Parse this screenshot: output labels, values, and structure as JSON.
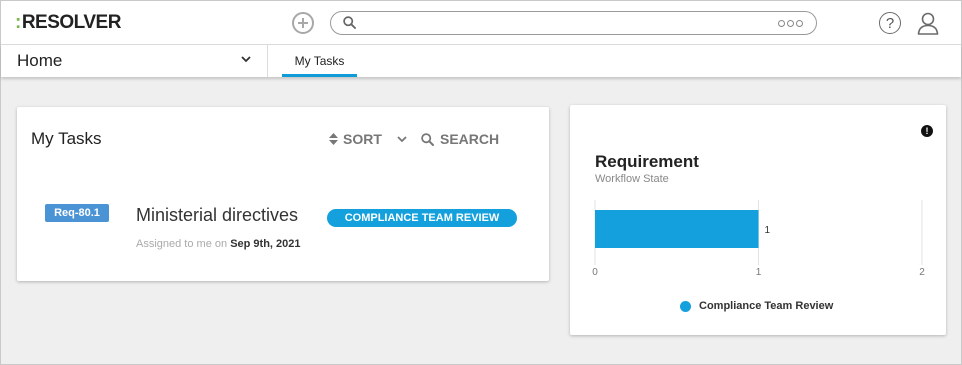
{
  "app": {
    "logo_mark": ":",
    "logo_text": "RESOLVER"
  },
  "search": {
    "placeholder": "",
    "value": ""
  },
  "nav": {
    "home_label": "Home",
    "tabs": [
      {
        "label": "My Tasks",
        "active": true
      }
    ]
  },
  "tasks_card": {
    "title": "My Tasks",
    "sort_label": "SORT",
    "search_label": "SEARCH",
    "tasks": [
      {
        "id_badge": "Req-80.1",
        "name": "Ministerial directives",
        "status": "COMPLIANCE TEAM REVIEW",
        "assigned_prefix": "Assigned to me on",
        "assigned_date": "Sep 9th, 2021"
      }
    ]
  },
  "requirement_card": {
    "title": "Requirement",
    "subtitle": "Workflow State",
    "alert_symbol": "!"
  },
  "chart_data": {
    "type": "bar",
    "orientation": "horizontal",
    "categories": [
      ""
    ],
    "series": [
      {
        "name": "Compliance Team Review",
        "values": [
          1
        ],
        "color": "#13a0dc"
      }
    ],
    "xlim": [
      0,
      2
    ],
    "x_ticks": [
      "0",
      "1",
      "2"
    ],
    "data_labels": [
      "1"
    ],
    "grid": true,
    "legend": "bottom"
  },
  "colors": {
    "accent": "#0f9bd7",
    "badge_blue": "#4a93d4",
    "status_blue": "#13a0dc",
    "logo_green": "#7ab648"
  }
}
